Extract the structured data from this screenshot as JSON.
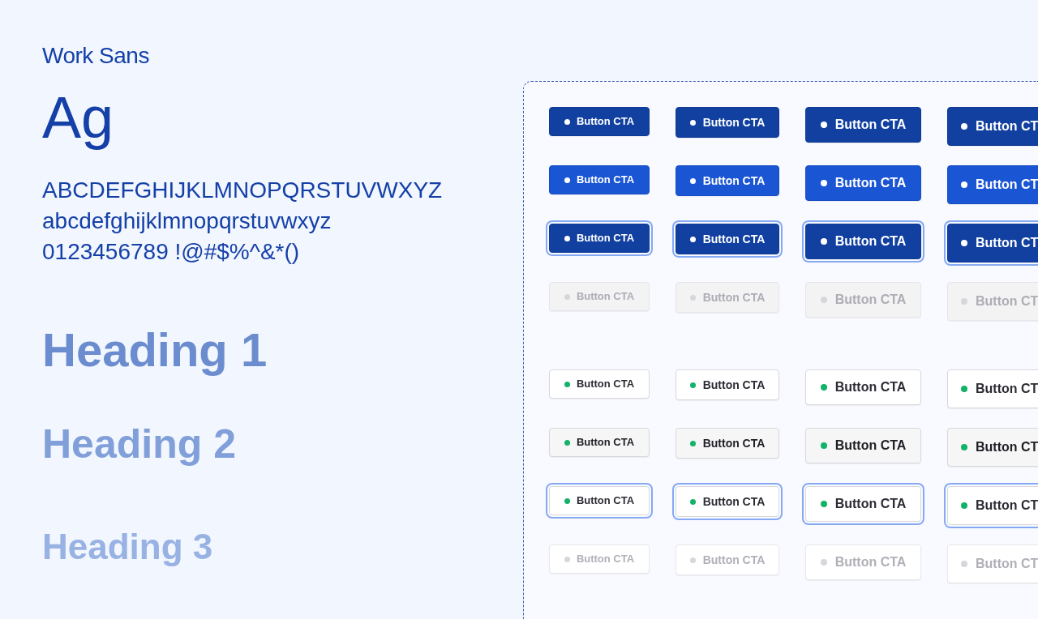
{
  "typography": {
    "font_name": "Work Sans",
    "specimen": "Ag",
    "glyph_lines": [
      "ABCDEFGHIJKLMNOPQRSTUVWXYZ",
      "abcdefghijklmnopqrstuvwxyz",
      "0123456789 !@#$%^&*()"
    ],
    "headings": [
      "Heading 1",
      "Heading 2",
      "Heading 3"
    ]
  },
  "button_groups": [
    {
      "kind": "primary",
      "rows": [
        {
          "kind": "default",
          "buttons": [
            {
              "label": "Button CTA",
              "kind": "sm"
            },
            {
              "label": "Button CTA",
              "kind": "md"
            },
            {
              "label": "Button CTA",
              "kind": "lg"
            },
            {
              "label": "Button CT",
              "kind": "xl"
            }
          ]
        },
        {
          "kind": "hover",
          "buttons": [
            {
              "label": "Button CTA",
              "kind": "sm"
            },
            {
              "label": "Button CTA",
              "kind": "md"
            },
            {
              "label": "Button CTA",
              "kind": "lg"
            },
            {
              "label": "Button CT",
              "kind": "xl"
            }
          ]
        },
        {
          "kind": "focus",
          "buttons": [
            {
              "label": "Button CTA",
              "kind": "sm"
            },
            {
              "label": "Button CTA",
              "kind": "md"
            },
            {
              "label": "Button CTA",
              "kind": "lg"
            },
            {
              "label": "Button CT",
              "kind": "xl"
            }
          ]
        },
        {
          "kind": "disabled",
          "buttons": [
            {
              "label": "Button CTA",
              "kind": "sm"
            },
            {
              "label": "Button CTA",
              "kind": "md"
            },
            {
              "label": "Button CTA",
              "kind": "lg"
            },
            {
              "label": "Button CT",
              "kind": "xl"
            }
          ]
        }
      ]
    },
    {
      "kind": "secondary",
      "rows": [
        {
          "kind": "default",
          "buttons": [
            {
              "label": "Button CTA",
              "kind": "sm"
            },
            {
              "label": "Button CTA",
              "kind": "md"
            },
            {
              "label": "Button CTA",
              "kind": "lg"
            },
            {
              "label": "Button CT",
              "kind": "xl"
            }
          ]
        },
        {
          "kind": "hover",
          "buttons": [
            {
              "label": "Button CTA",
              "kind": "sm"
            },
            {
              "label": "Button CTA",
              "kind": "md"
            },
            {
              "label": "Button CTA",
              "kind": "lg"
            },
            {
              "label": "Button CT",
              "kind": "xl"
            }
          ]
        },
        {
          "kind": "focus",
          "buttons": [
            {
              "label": "Button CTA",
              "kind": "sm"
            },
            {
              "label": "Button CTA",
              "kind": "md"
            },
            {
              "label": "Button CTA",
              "kind": "lg"
            },
            {
              "label": "Button CT",
              "kind": "xl"
            }
          ]
        },
        {
          "kind": "disabled",
          "buttons": [
            {
              "label": "Button CTA",
              "kind": "sm"
            },
            {
              "label": "Button CTA",
              "kind": "md"
            },
            {
              "label": "Button CTA",
              "kind": "lg"
            },
            {
              "label": "Button CT",
              "kind": "xl"
            }
          ]
        }
      ]
    }
  ]
}
